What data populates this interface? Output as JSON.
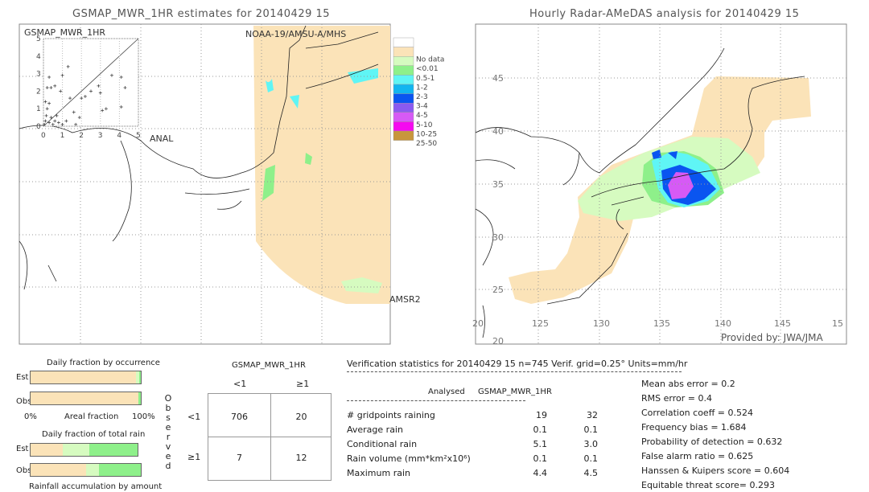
{
  "left_map": {
    "title": "GSMAP_MWR_1HR estimates for 20140429 15",
    "sensor_top": "NOAA-19/AMSU-A/MHS",
    "sensor_bottom": "AMSR2",
    "inset": {
      "ylabel": "GSMAP_MWR_1HR",
      "xlabel": "ANAL",
      "ticks": [
        "0",
        "1",
        "2",
        "3",
        "4",
        "5"
      ]
    }
  },
  "right_map": {
    "title": "Hourly Radar-AMeDAS analysis for 20140429 15",
    "credit": "Provided by: JWA/JMA",
    "lat_labels": [
      "45",
      "40",
      "35",
      "30",
      "25",
      "20"
    ],
    "lon_labels": [
      "20",
      "125",
      "130",
      "135",
      "140",
      "145",
      "15"
    ]
  },
  "legend": {
    "items": [
      {
        "label": "",
        "color": "#ffffff"
      },
      {
        "label": "No data",
        "color": "#fbe3b8"
      },
      {
        "label": "<0.01",
        "color": "#d6fbc0"
      },
      {
        "label": "0.5-1",
        "color": "#8ef08a"
      },
      {
        "label": "1-2",
        "color": "#5ff5f5"
      },
      {
        "label": "2-3",
        "color": "#12b5f0"
      },
      {
        "label": "3-4",
        "color": "#0a55f0"
      },
      {
        "label": "4-5",
        "color": "#8a5af0"
      },
      {
        "label": "5-10",
        "color": "#d65af5"
      },
      {
        "label": "10-25",
        "color": "#f50af0"
      },
      {
        "label": "25-50",
        "color": "#c8963c"
      }
    ]
  },
  "chart_data": {
    "type": "scatter",
    "xlabel": "ANAL",
    "ylabel": "GSMAP_MWR_1HR",
    "xlim": [
      0,
      5
    ],
    "ylim": [
      0,
      5
    ],
    "grid": true,
    "diagonal": true,
    "points": [
      [
        0.05,
        0.1
      ],
      [
        0.1,
        0.3
      ],
      [
        0.15,
        0.6
      ],
      [
        0.2,
        1.0
      ],
      [
        0.1,
        1.4
      ],
      [
        0.3,
        0.2
      ],
      [
        0.4,
        0.5
      ],
      [
        0.5,
        0.1
      ],
      [
        0.6,
        0.3
      ],
      [
        0.8,
        0.2
      ],
      [
        1.0,
        0.1
      ],
      [
        0.3,
        1.3
      ],
      [
        0.2,
        2.2
      ],
      [
        0.4,
        2.2
      ],
      [
        0.6,
        2.3
      ],
      [
        0.9,
        2.0
      ],
      [
        0.3,
        2.8
      ],
      [
        1.3,
        3.4
      ],
      [
        1.0,
        2.9
      ],
      [
        1.4,
        1.6
      ],
      [
        1.6,
        0.8
      ],
      [
        1.9,
        0.5
      ],
      [
        2.0,
        1.6
      ],
      [
        2.2,
        1.7
      ],
      [
        2.5,
        2.0
      ],
      [
        2.9,
        2.3
      ],
      [
        3.0,
        1.9
      ],
      [
        3.3,
        1.0
      ],
      [
        3.1,
        0.9
      ],
      [
        3.6,
        2.9
      ],
      [
        4.1,
        2.8
      ],
      [
        4.3,
        2.2
      ],
      [
        4.1,
        1.1
      ],
      [
        1.7,
        0.1
      ],
      [
        1.2,
        0.3
      ],
      [
        0.7,
        0.6
      ]
    ]
  },
  "occurrence": {
    "title": "Daily fraction by occurrence",
    "est_label": "Est",
    "obs_label": "Obs",
    "axis_left": "0%",
    "axis_mid": "Areal fraction",
    "axis_right": "100%",
    "est_fractions": [
      0.955,
      0.03,
      0.015
    ],
    "obs_fractions": [
      0.975,
      0.0,
      0.025
    ]
  },
  "total_rain": {
    "title": "Daily fraction of total rain",
    "est_label": "Est",
    "obs_label": "Obs",
    "footer": "Rainfall accumulation by amount",
    "est_fractions": [
      0.3,
      0.25,
      0.45
    ],
    "obs_fractions": [
      0.5,
      0.12,
      0.38
    ]
  },
  "contingency": {
    "header": "GSMAP_MWR_1HR",
    "col_labels": [
      "<1",
      "≥1"
    ],
    "row_labels": [
      "<1",
      "≥1"
    ],
    "side_label": "Observed",
    "cells": [
      [
        "706",
        "20"
      ],
      [
        "7",
        "12"
      ]
    ]
  },
  "stats": {
    "header": "Verification statistics for 20140429 15   n=745   Verif. grid=0.25°   Units=mm/hr",
    "col_analysed": "Analysed",
    "col_est": "GSMAP_MWR_1HR",
    "rows": [
      {
        "label": "# gridpoints raining",
        "a": "19",
        "b": "32"
      },
      {
        "label": "Average rain",
        "a": "0.1",
        "b": "0.1"
      },
      {
        "label": "Conditional rain",
        "a": "5.1",
        "b": "3.0"
      },
      {
        "label": "Rain volume (mm*km²x10⁶)",
        "a": "0.1",
        "b": "0.1"
      },
      {
        "label": "Maximum rain",
        "a": "4.4",
        "b": "4.5"
      }
    ],
    "scores": [
      "Mean abs error = 0.2",
      "RMS error = 0.4",
      "Correlation coeff = 0.524",
      "Frequency bias = 1.684",
      "Probability of detection = 0.632",
      "False alarm ratio = 0.625",
      "Hanssen & Kuipers score = 0.604",
      "Equitable threat score= 0.293"
    ]
  }
}
